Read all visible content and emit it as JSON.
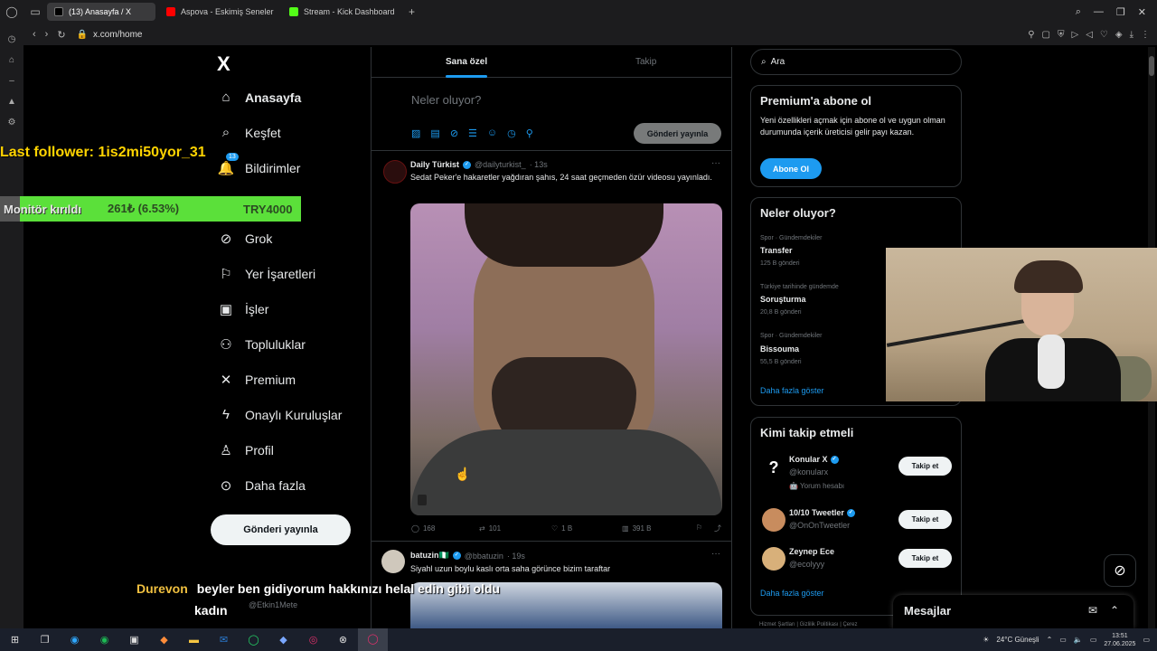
{
  "browser": {
    "tabs": [
      {
        "title": "(13) Anasayfa / X",
        "active": true,
        "favicon": "x-icon",
        "color": "#000000"
      },
      {
        "title": "Aspova - Eskimiş Seneler",
        "active": false,
        "favicon": "youtube-icon",
        "color": "#ff0000"
      },
      {
        "title": "Stream - Kick Dashboard",
        "active": false,
        "favicon": "kick-icon",
        "color": "#53fc18"
      }
    ],
    "new_tab": "+",
    "url": "x.com/home"
  },
  "sidebar": {
    "logo": "X",
    "items": [
      {
        "label": "Anasayfa",
        "icon": "home-icon",
        "bold": true
      },
      {
        "label": "Keşfet",
        "icon": "search-icon"
      },
      {
        "label": "Bildirimler",
        "icon": "bell-icon",
        "badge": "13"
      },
      {
        "label": "Grok",
        "icon": "grok-icon"
      },
      {
        "label": "Yer İşaretleri",
        "icon": "bookmark-icon"
      },
      {
        "label": "İşler",
        "icon": "briefcase-icon"
      },
      {
        "label": "Topluluklar",
        "icon": "communities-icon"
      },
      {
        "label": "Premium",
        "icon": "x-premium-icon"
      },
      {
        "label": "Onaylı Kuruluşlar",
        "icon": "lightning-icon"
      },
      {
        "label": "Profil",
        "icon": "profile-icon"
      },
      {
        "label": "Daha fazla",
        "icon": "more-circle-icon"
      }
    ],
    "post_button": "Gönderi yayınla"
  },
  "feed": {
    "tabs": [
      {
        "label": "Sana özel",
        "active": true
      },
      {
        "label": "Takip",
        "active": false
      }
    ],
    "compose_placeholder": "Neler oluyor?",
    "compose_button": "Gönderi yayınla",
    "tweets": [
      {
        "name": "Daily Türkist",
        "handle": "@dailyturkist_",
        "time": "· 13s",
        "text": "Sedat Peker'e hakaretler yağdıran şahıs, 24 saat geçmeden özür videosu yayınladı.",
        "replies": "168",
        "retweets": "101",
        "likes": "1 B",
        "views": "391 B"
      },
      {
        "name": "batuzin🇳🇬",
        "handle": "@bbatuzin",
        "time": "· 19s",
        "text": "Siyahl uzun boylu kaslı orta saha görünce bizim taraftar"
      }
    ]
  },
  "right": {
    "search_placeholder": "Ara",
    "premium": {
      "title": "Premium'a abone ol",
      "text": "Yeni özellikleri açmak için abone ol ve uygun olman durumunda içerik üreticisi gelir payı kazan.",
      "button": "Abone Ol"
    },
    "trends": {
      "title": "Neler oluyor?",
      "items": [
        {
          "meta": "Spor · Gündemdekiler",
          "name": "Transfer",
          "count": "125 B gönderi"
        },
        {
          "meta": "Türkiye tarihinde gündemde",
          "name": "Soruşturma",
          "count": "20,8 B gönderi"
        },
        {
          "meta": "Spor · Gündemdekiler",
          "name": "Bissouma",
          "count": "55,5 B gönderi"
        }
      ],
      "show_more": "Daha fazla göster"
    },
    "who_to_follow": {
      "title": "Kimi takip etmeli",
      "items": [
        {
          "name": "Konular X",
          "handle": "@konularx",
          "extra": "🤖 Yorum hesabı",
          "button": "Takip et"
        },
        {
          "name": "10/10 Tweetler",
          "handle": "@OnOnTweetler",
          "button": "Takip et"
        },
        {
          "name": "Zeynep Ece",
          "handle": "@ecolyyy",
          "button": "Takip et"
        }
      ],
      "show_more": "Daha fazla göster"
    },
    "footer": "Hizmet Şartları  |  Gizlilik Politikası  |  Çerez"
  },
  "messages": {
    "title": "Mesajlar"
  },
  "overlay": {
    "last_follower": "Last follower: 1is2mi50yor_31",
    "ticker_left": "Monitör kırıldı",
    "ticker_mid": "261₺ (6.53%)",
    "ticker_right": "TRY4000",
    "chat_user": "Durevon",
    "chat_message": "beyler ben gidiyorum hakkınızı helal edin gibi oldu",
    "chat_message_2": "kadın",
    "chat_sub": "@Etkin1Mete"
  },
  "taskbar": {
    "weather": "24°C Güneşli",
    "time": "13:51",
    "date": "27.06.2025"
  }
}
